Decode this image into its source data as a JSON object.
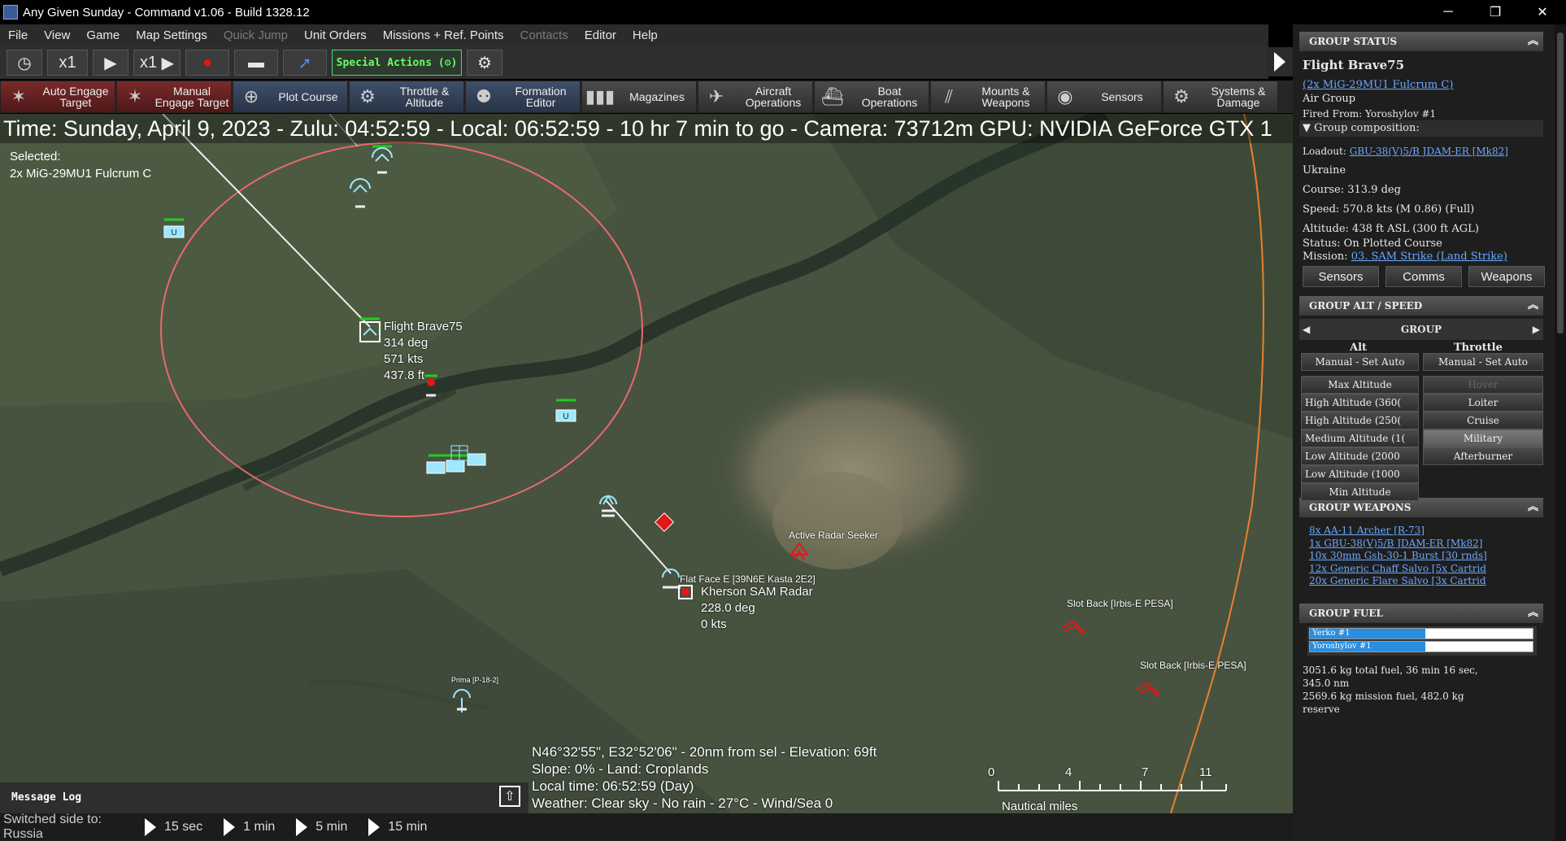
{
  "window": {
    "title": "Any Given Sunday - Command v1.06 - Build 1328.12",
    "minimize": "─",
    "maximize": "❐",
    "close": "✕"
  },
  "menu": {
    "items": [
      {
        "label": "File",
        "enabled": true
      },
      {
        "label": "View",
        "enabled": true
      },
      {
        "label": "Game",
        "enabled": true
      },
      {
        "label": "Map Settings",
        "enabled": true
      },
      {
        "label": "Quick Jump",
        "enabled": false
      },
      {
        "label": "Unit Orders",
        "enabled": true
      },
      {
        "label": "Missions + Ref. Points",
        "enabled": true
      },
      {
        "label": "Contacts",
        "enabled": false
      },
      {
        "label": "Editor",
        "enabled": true
      },
      {
        "label": "Help",
        "enabled": true
      }
    ]
  },
  "controls": {
    "time_compression": "x1",
    "step_compression": "x1",
    "special_actions": "Special Actions",
    "icons": {
      "clock": "clock-icon",
      "play": "play-icon",
      "step": "step-play-icon",
      "record": "record-icon",
      "helmet": "helmet-icon",
      "pointer": "pointer-icon",
      "gear": "gear-icon"
    }
  },
  "toolbar": {
    "buttons": [
      {
        "line1": "Auto Engage",
        "line2": "Target",
        "icon": "auto-engage-icon",
        "glyph": "✶",
        "style": "red"
      },
      {
        "line1": "Manual",
        "line2": "Engage Target",
        "icon": "manual-engage-icon",
        "glyph": "✶",
        "style": "red"
      },
      {
        "line1": "Plot Course",
        "line2": "",
        "icon": "plot-course-icon",
        "glyph": "⊕",
        "style": "blue"
      },
      {
        "line1": "Throttle &",
        "line2": "Altitude",
        "icon": "throttle-icon",
        "glyph": "⚙",
        "style": "blue"
      },
      {
        "line1": "Formation",
        "line2": "Editor",
        "icon": "formation-icon",
        "glyph": "⚉",
        "style": "blue"
      },
      {
        "line1": "Magazines",
        "line2": "",
        "icon": "magazines-icon",
        "glyph": "▮▮▮",
        "style": "gray"
      },
      {
        "line1": "Aircraft",
        "line2": "Operations",
        "icon": "aircraft-icon",
        "glyph": "✈",
        "style": "gray"
      },
      {
        "line1": "Boat",
        "line2": "Operations",
        "icon": "boat-icon",
        "glyph": "⛴",
        "style": "gray"
      },
      {
        "line1": "Mounts &",
        "line2": "Weapons",
        "icon": "mounts-icon",
        "glyph": "⫽",
        "style": "gray"
      },
      {
        "line1": "Sensors",
        "line2": "",
        "icon": "sensors-icon",
        "glyph": "◉",
        "style": "gray"
      },
      {
        "line1": "Systems &",
        "line2": "Damage",
        "icon": "systems-icon",
        "glyph": "⚙",
        "style": "gray"
      }
    ]
  },
  "map": {
    "timebar": "Time: Sunday, April 9, 2023 - Zulu: 04:52:59 - Local: 06:52:59 - 10 hr 7 min to go -  Camera: 73712m  GPU: NVIDIA GeForce GTX 1",
    "selected_label": "Selected:",
    "selected_value": "2x MiG-29MU1 Fulcrum C",
    "flight_label": {
      "name": "Flight Brave75",
      "course": "314 deg",
      "speed": "571 kts",
      "alt": "437.8 ft"
    },
    "sam_label": {
      "name": "Kherson SAM Radar",
      "course": "228.0 deg",
      "speed": "0 kts"
    },
    "flat_face": "Flat Face E [39N6E Kasta 2E2]",
    "active_seeker": "Active Radar Seeker",
    "slot_back_1": "Slot Back [Irbis-E PESA]",
    "slot_back_2": "Slot Back [Irbis-E PESA]",
    "prima": "Prima [P-18-2]",
    "coord_lines": [
      "N46°32'55\", E32°52'06\" - 20nm from sel - Elevation: 69ft",
      "Slope: 0%  - Land: Croplands",
      "Local time: 06:52:59 (Day)",
      "Weather: Clear sky - No rain - 27°C - Wind/Sea 0"
    ],
    "scale": {
      "ticks": [
        "0",
        "4",
        "7",
        "11"
      ],
      "label": "Nautical miles"
    },
    "colors": {
      "range_ring": "#e86a6a",
      "outer_ring": "#e8822a",
      "friendly": "#9ee7ff",
      "hostile": "#e01818"
    }
  },
  "message_log": {
    "label": "Message Log",
    "icon": "expand-up-icon"
  },
  "status": {
    "text": "Switched side to: Russia",
    "speeds": [
      "15 sec",
      "1 min",
      "5 min",
      "15 min"
    ]
  },
  "panel": {
    "group_status": {
      "header": "GROUP STATUS",
      "name": "Flight Brave75",
      "unit": "(2x MiG-29MU1 Fulcrum C)",
      "type": "Air Group",
      "fired_from": "Fired From: Yoroshylov #1",
      "composition": "Group composition:",
      "loadout_label": "Loadout:",
      "loadout_value": "GBU-38(V)5/B JDAM-ER [Mk82]",
      "country": "Ukraine",
      "course": "Course: 313.9 deg",
      "speed": "Speed: 570.8 kts (M 0.86) (Full)",
      "altitude": "Altitude: 438 ft ASL (300 ft AGL)",
      "status": "Status: On Plotted Course",
      "mission_label": "Mission:",
      "mission_value": "03. SAM Strike (Land Strike)",
      "buttons": [
        "Sensors",
        "Comms",
        "Weapons"
      ]
    },
    "alt_speed": {
      "header": "GROUP ALT / SPEED",
      "group": "GROUP",
      "alt_col": "Alt",
      "throttle_col": "Throttle",
      "alt_manual": "Manual - Set Auto",
      "throttle_manual": "Manual - Set Auto",
      "alt_buttons": [
        "Max Altitude",
        "High Altitude (360(",
        "High Altitude (250(",
        "Medium Altitude (1(",
        "Low Altitude (2000",
        "Low Altitude (1000",
        "Min Altitude"
      ],
      "throttle_buttons": [
        "Hover",
        "Loiter",
        "Cruise",
        "Military",
        "Afterburner"
      ]
    },
    "weapons": {
      "header": "GROUP WEAPONS",
      "items": [
        "8x AA-11 Archer [R-73]",
        "1x GBU-38(V)5/B JDAM-ER [Mk82]",
        "10x 30mm Gsh-30-1 Burst [30 rnds]",
        "12x Generic Chaff Salvo [5x Cartrid",
        "20x Generic Flare Salvo [3x Cartrid"
      ]
    },
    "fuel": {
      "header": "GROUP FUEL",
      "bars": [
        {
          "label": "Yerko #1",
          "fraction": 0.52
        },
        {
          "label": "Yoroshylov #1",
          "fraction": 0.52
        }
      ],
      "line1": "3051.6 kg total fuel, 36 min 16 sec,",
      "line2": "345.0 nm",
      "line3": "2569.6 kg mission fuel, 482.0 kg",
      "line4": "reserve"
    }
  }
}
